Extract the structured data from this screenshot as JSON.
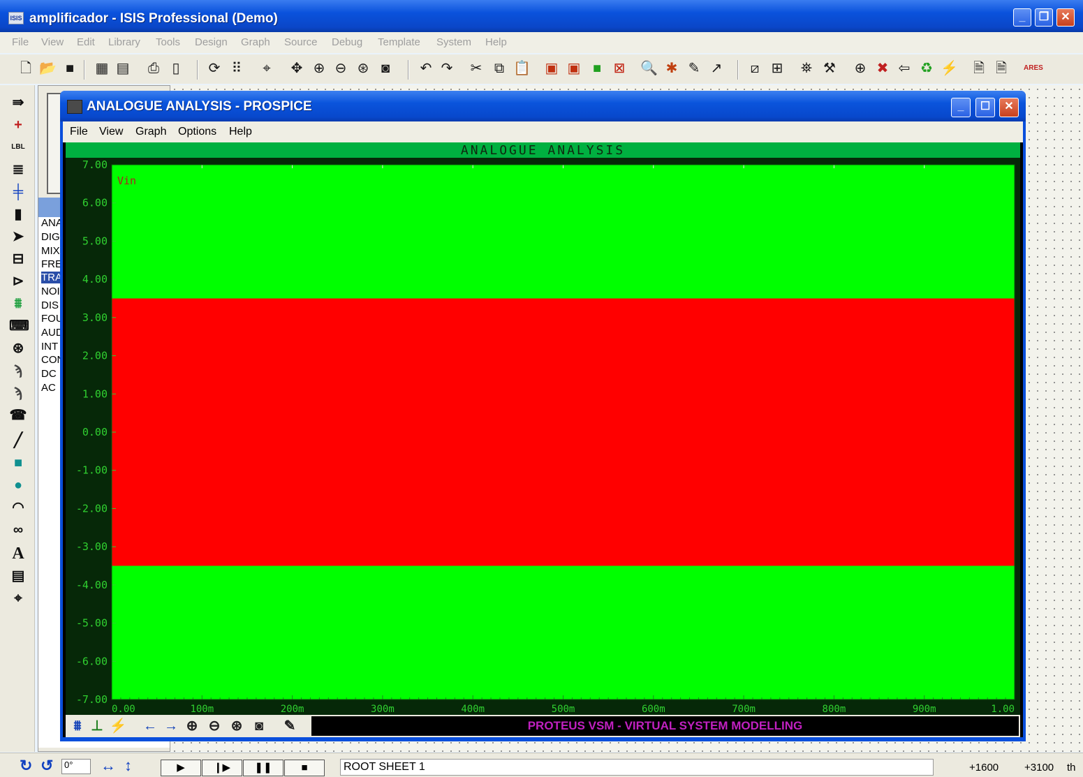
{
  "main_window": {
    "title": "amplificador - ISIS Professional (Demo)",
    "icon_label": "ISIS",
    "menus": [
      "File",
      "View",
      "Edit",
      "Library",
      "Tools",
      "Design",
      "Graph",
      "Source",
      "Debug",
      "Template",
      "System",
      "Help"
    ]
  },
  "left_strip": {
    "items": [
      "component-mode",
      "junction",
      "wire-label",
      "text-script",
      "bus",
      "subcircuit",
      "selection",
      "terminal",
      "device-pin",
      "graph",
      "tape",
      "generator",
      "voltage-probe",
      "current-probe",
      "virtual-instrument",
      "line",
      "box",
      "circle",
      "arc",
      "path",
      "text",
      "symbol",
      "marker"
    ],
    "lbl_text": "LBL",
    "text_glyph": "A"
  },
  "graph_list": {
    "items": [
      "ANA",
      "DIG",
      "MIX",
      "FRE",
      "TRA",
      "NOI",
      "DIS",
      "FOU",
      "AUD",
      "INT",
      "CON",
      "DC",
      "AC"
    ],
    "selected": "TRA"
  },
  "prospice": {
    "title": "ANALOGUE ANALYSIS - PROSPICE",
    "menus": [
      "File",
      "View",
      "Graph",
      "Options",
      "Help"
    ],
    "banner": "PROTEUS VSM - VIRTUAL SYSTEM MODELLING"
  },
  "chart_data": {
    "type": "area",
    "title": "ANALOGUE ANALYSIS",
    "xlabel": "",
    "ylabel": "",
    "x_tick_labels": [
      "0.00",
      "100m",
      "200m",
      "300m",
      "400m",
      "500m",
      "600m",
      "700m",
      "800m",
      "900m",
      "1.00"
    ],
    "y_tick_labels": [
      "7.00",
      "6.00",
      "5.00",
      "4.00",
      "3.00",
      "2.00",
      "1.00",
      "0.00",
      "-1.00",
      "-2.00",
      "-3.00",
      "-4.00",
      "-5.00",
      "-6.00",
      "-7.00"
    ],
    "xlim": [
      0,
      1.0
    ],
    "ylim": [
      -7.0,
      7.0
    ],
    "grid": true,
    "series": [
      {
        "name": "Vin",
        "color": "#ff0000",
        "x": [
          0,
          1.0
        ],
        "upper": [
          3.5,
          3.5
        ],
        "lower": [
          -3.5,
          -3.5
        ]
      }
    ],
    "background_color": "#00ff00"
  },
  "status_bar": {
    "rotation": "0°",
    "sheet": "ROOT SHEET 1",
    "coord_x": "+1600",
    "coord_y": "+3100",
    "units": "th"
  }
}
